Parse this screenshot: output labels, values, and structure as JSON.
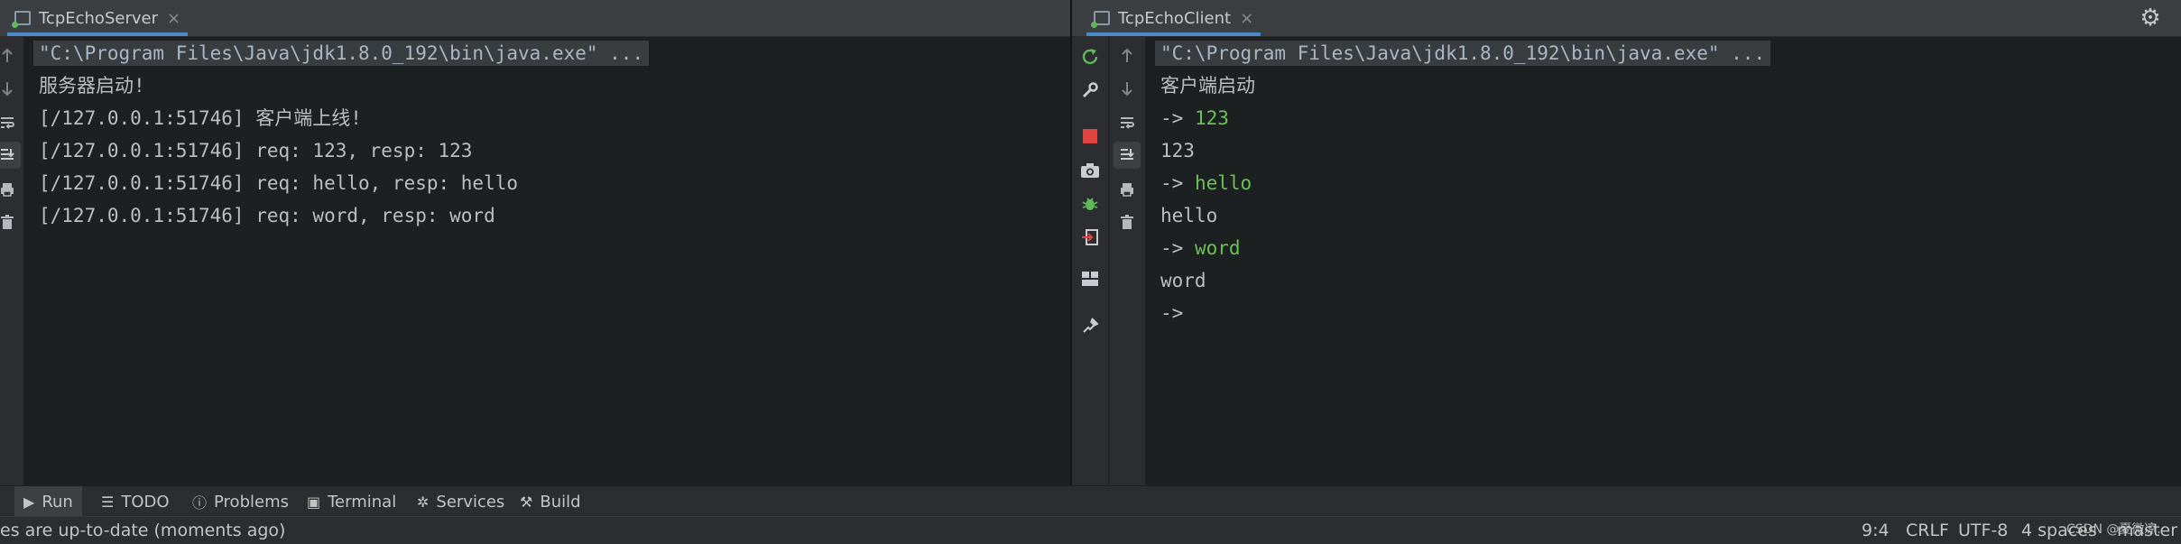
{
  "colors": {
    "console_bg": "#1c2020",
    "tab_underline": "#4a88c7",
    "input_green": "#6cc05a",
    "stop_red": "#e0443e",
    "rerun_green": "#5fb85a"
  },
  "left_panel": {
    "tab": {
      "label": "TcpEchoServer",
      "close": "×"
    },
    "lines": [
      "\"C:\\Program Files\\Java\\jdk1.8.0_192\\bin\\java.exe\" ...",
      "服务器启动!",
      "[/127.0.0.1:51746] 客户端上线!",
      "[/127.0.0.1:51746] req: 123, resp: 123",
      "[/127.0.0.1:51746] req: hello, resp: hello",
      "[/127.0.0.1:51746] req: word, resp: word"
    ]
  },
  "right_panel": {
    "tab": {
      "label": "TcpEchoClient",
      "close": "×"
    },
    "lines": [
      {
        "text": "\"C:\\Program Files\\Java\\jdk1.8.0_192\\bin\\java.exe\" ..."
      },
      {
        "text": "客户端启动"
      },
      {
        "prompt": "-> ",
        "input": "123"
      },
      {
        "text": "123"
      },
      {
        "prompt": "-> ",
        "input": "hello"
      },
      {
        "text": "hello"
      },
      {
        "prompt": "-> ",
        "input": "word"
      },
      {
        "text": "word"
      },
      {
        "prompt": "-> ",
        "input": ""
      }
    ]
  },
  "settings_icon": "⚙",
  "tool_window_bar": {
    "items": [
      {
        "label": "Run",
        "icon": "play-icon",
        "glyph": "▶"
      },
      {
        "label": "TODO",
        "icon": "list-icon",
        "glyph": "☰"
      },
      {
        "label": "Problems",
        "icon": "info-icon",
        "glyph": "ⓘ"
      },
      {
        "label": "Terminal",
        "icon": "terminal-icon",
        "glyph": "▣"
      },
      {
        "label": "Services",
        "icon": "services-icon",
        "glyph": "✲"
      },
      {
        "label": "Build",
        "icon": "hammer-icon",
        "glyph": "⚒"
      }
    ]
  },
  "status_bar": {
    "message": "es are up-to-date (moments ago)",
    "position": "9:4",
    "line_separator": "CRLF",
    "encoding": "UTF-8",
    "indent": "4 spaces",
    "branch": "master",
    "watermark": "CSDN @夏微凉."
  }
}
